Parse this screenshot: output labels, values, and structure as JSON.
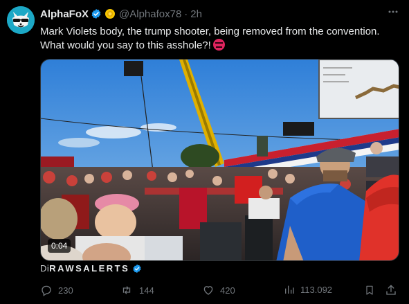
{
  "author": {
    "display_name": "AlphaFoX",
    "handle": "@Alphafox78",
    "separator": "·",
    "time": "2h"
  },
  "tweet": {
    "line1": "Mark Violets body, the trump shooter, being removed from the convention.",
    "line2": "What would you say to this asshole?!",
    "emoji": "angry-face-emoji"
  },
  "media": {
    "duration": "0:04"
  },
  "watermark": {
    "prefix": "Di",
    "name": "RAWSALERTS"
  },
  "actions": {
    "replies": "230",
    "reposts": "144",
    "likes": "420",
    "views": "113.092"
  },
  "icons": {
    "more": "more-options-icon",
    "verified": "verified-badge-icon",
    "affiliate": "affiliate-badge-icon",
    "reply": "reply-icon",
    "repost": "repost-icon",
    "like": "heart-icon",
    "views": "views-icon",
    "bookmark": "bookmark-icon",
    "share": "share-icon"
  },
  "colors": {
    "background": "#000000",
    "text": "#e7e9ea",
    "muted": "#71767b",
    "verified_blue": "#1d9bf0",
    "affiliate_gold": "#f7c600"
  }
}
